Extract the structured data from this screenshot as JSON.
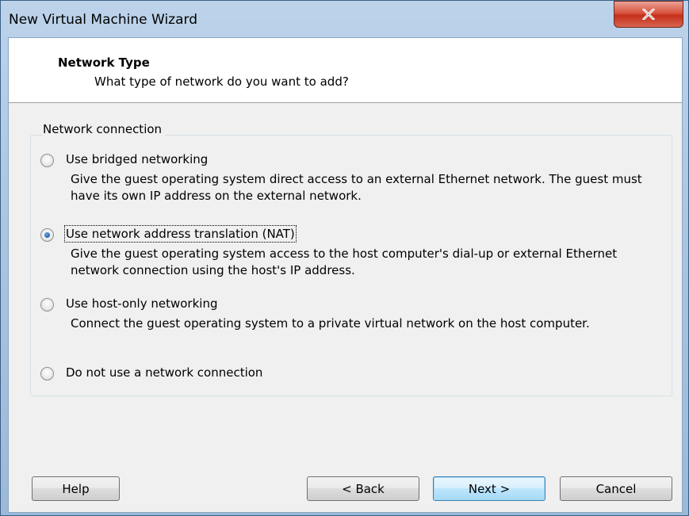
{
  "window": {
    "title": "New Virtual Machine Wizard",
    "close_glyph": "✕"
  },
  "header": {
    "title": "Network Type",
    "subtitle": "What type of network do you want to add?"
  },
  "group": {
    "label": "Network connection"
  },
  "options": [
    {
      "label": "Use bridged networking",
      "description": "Give the guest operating system direct access to an external Ethernet network. The guest must have its own IP address on the external network.",
      "selected": false
    },
    {
      "label": "Use network address translation (NAT)",
      "description": "Give the guest operating system access to the host computer's dial-up or external Ethernet network connection using the host's IP address.",
      "selected": true
    },
    {
      "label": "Use host-only networking",
      "description": "Connect the guest operating system to a private virtual network on the host computer.",
      "selected": false
    },
    {
      "label": "Do not use a network connection",
      "description": "",
      "selected": false
    }
  ],
  "buttons": {
    "help": "Help",
    "back": "< Back",
    "next": "Next >",
    "cancel": "Cancel"
  },
  "colors": {
    "accent": "#1d5fa8",
    "close_red": "#c4301b"
  }
}
